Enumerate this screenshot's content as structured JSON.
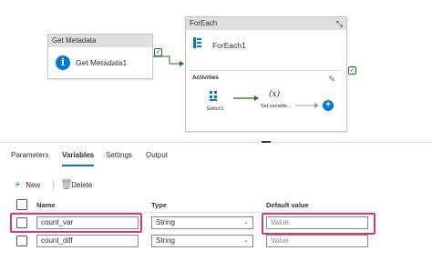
{
  "canvas": {
    "get_metadata": {
      "header": "Get Metadata",
      "name": "Get Metadata1",
      "icon": "info-icon"
    },
    "foreach": {
      "header": "ForEach",
      "name": "ForEach1",
      "activities_label": "Activities",
      "children": [
        {
          "name": "Switch1",
          "icon": "switch-icon"
        },
        {
          "name": "Set variable...",
          "icon": "variable-icon",
          "glyph": "(x)"
        }
      ]
    }
  },
  "tabs": [
    {
      "label": "Parameters",
      "active": false
    },
    {
      "label": "Variables",
      "active": true
    },
    {
      "label": "Settings",
      "active": false
    },
    {
      "label": "Output",
      "active": false
    }
  ],
  "toolbar": {
    "new_label": "New",
    "delete_label": "Delete"
  },
  "table": {
    "columns": [
      "Name",
      "Type",
      "Default value"
    ],
    "rows": [
      {
        "name": "count_var",
        "type": "String",
        "default_placeholder": "Value"
      },
      {
        "name": "count_diff",
        "type": "String",
        "default_placeholder": "Value"
      }
    ]
  },
  "colors": {
    "accent": "#0078d4",
    "highlight": "#d1397f",
    "success": "#107c10"
  }
}
